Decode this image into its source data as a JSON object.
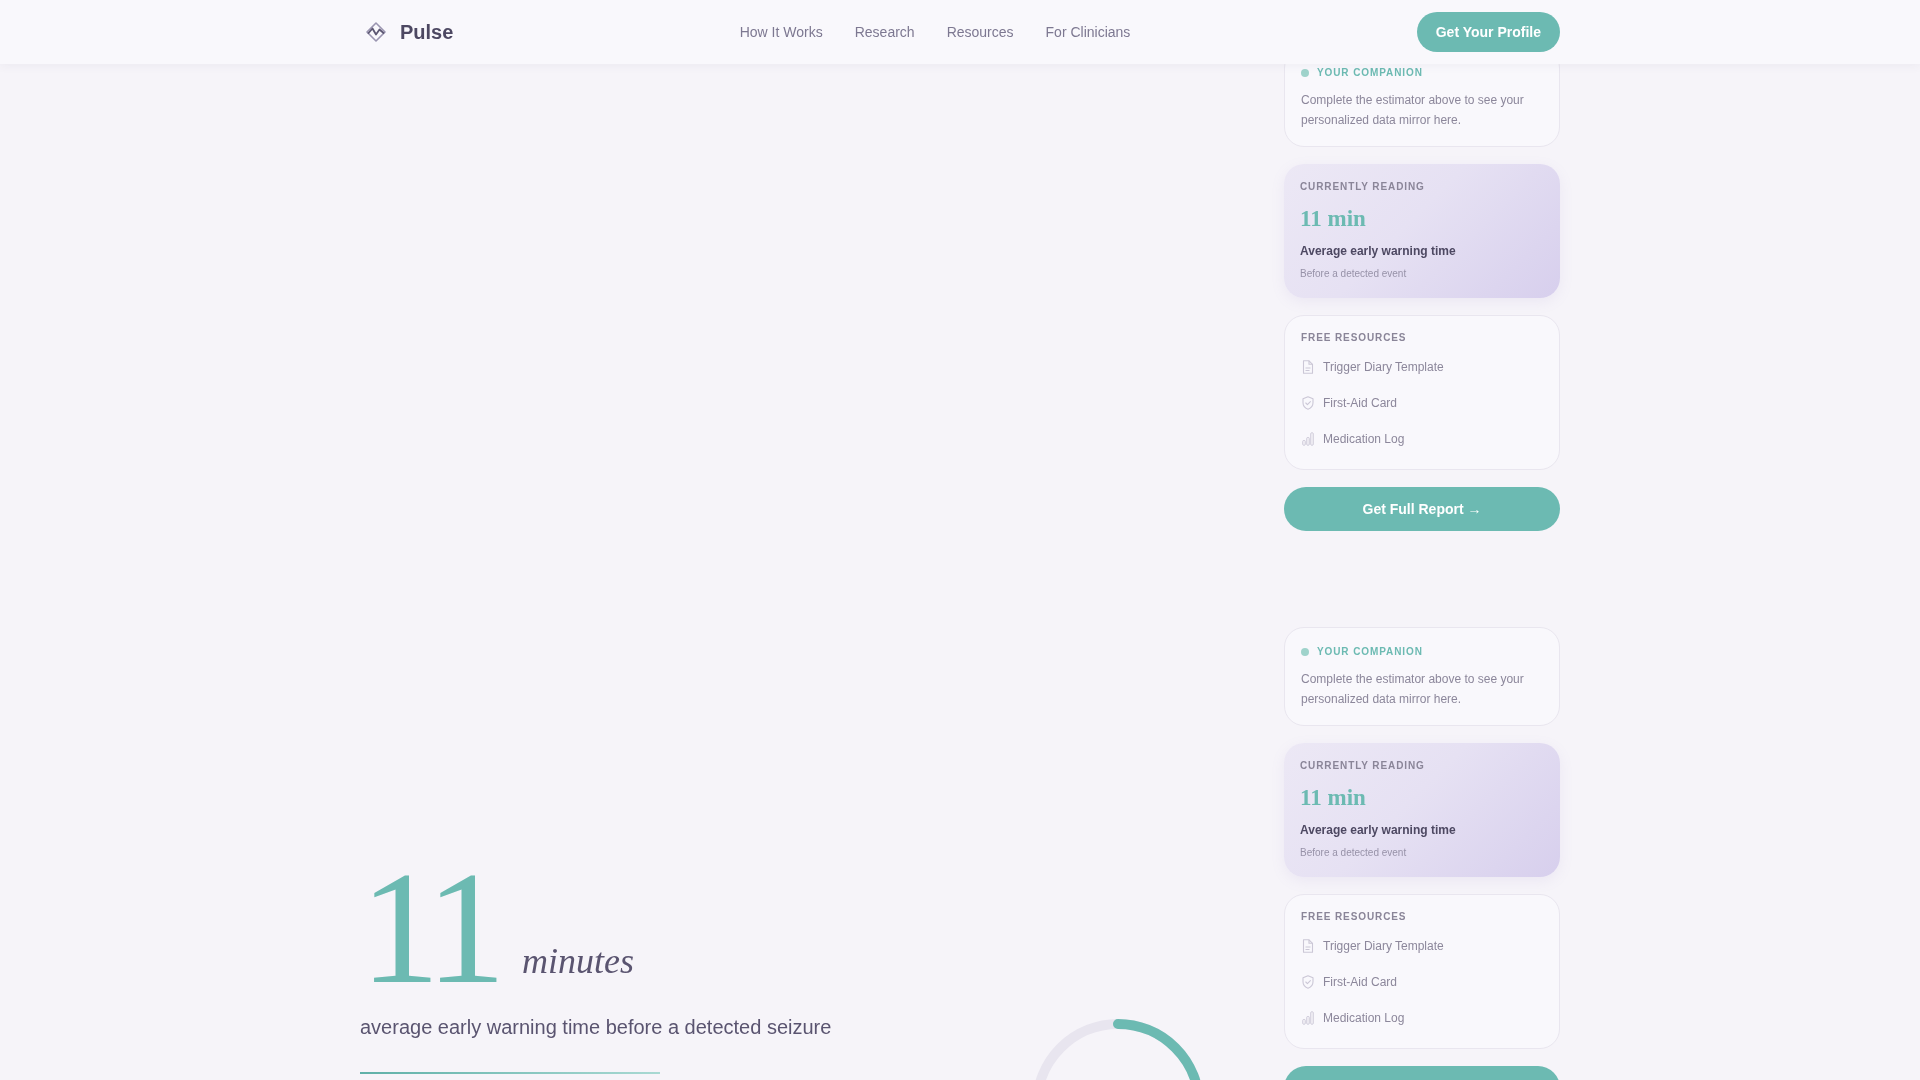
{
  "header": {
    "brand": "Pulse",
    "nav": [
      "How It Works",
      "Research",
      "Resources",
      "For Clinicians"
    ],
    "cta": "Get Your Profile"
  },
  "stat": {
    "value": "11",
    "unit": "minutes",
    "caption": "average early warning time before a detected seizure"
  },
  "sidebar_panels": [
    {
      "companion": {
        "label": "YOUR COMPANION",
        "text": "Complete the estimator above to see your personalized data mirror here."
      },
      "reading": {
        "label": "CURRENTLY READING",
        "value": "11 min",
        "title": "Average early warning time",
        "note": "Before a detected event"
      },
      "resources": {
        "label": "FREE RESOURCES",
        "items": [
          {
            "kind": "document",
            "label": "Trigger Diary Template"
          },
          {
            "kind": "shield",
            "label": "First-Aid Card"
          },
          {
            "kind": "chart",
            "label": "Medication Log"
          }
        ]
      },
      "button": "Get Full Report →"
    },
    {
      "companion": {
        "label": "YOUR COMPANION",
        "text": "Complete the estimator above to see your personalized data mirror here."
      },
      "reading": {
        "label": "CURRENTLY READING",
        "value": "11 min",
        "title": "Average early warning time",
        "note": "Before a detected event"
      },
      "resources": {
        "label": "FREE RESOURCES",
        "items": [
          {
            "kind": "document",
            "label": "Trigger Diary Template"
          },
          {
            "kind": "shield",
            "label": "First-Aid Card"
          },
          {
            "kind": "chart",
            "label": "Medication Log"
          }
        ]
      }
    }
  ]
}
